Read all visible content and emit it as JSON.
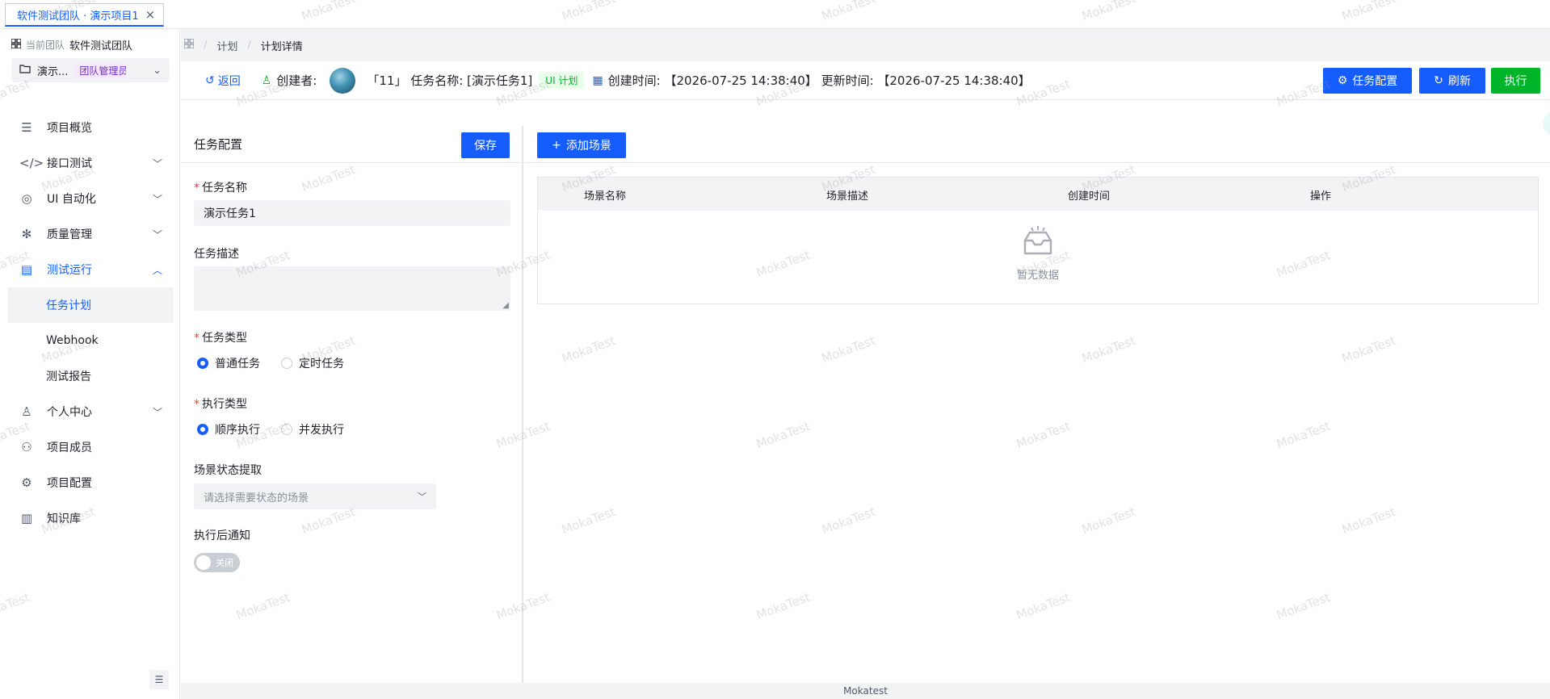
{
  "tab": {
    "label": "软件测试团队 · 演示项目1"
  },
  "sidebar": {
    "team_prefix": "当前团队",
    "team_name": "软件测试团队",
    "project_name": "演示...",
    "project_tag": "团队管理员",
    "items": [
      {
        "label": "项目概览"
      },
      {
        "label": "接口测试"
      },
      {
        "label": "UI 自动化"
      },
      {
        "label": "质量管理"
      },
      {
        "label": "测试运行"
      },
      {
        "label": "任务计划"
      },
      {
        "label": "Webhook"
      },
      {
        "label": "测试报告"
      },
      {
        "label": "个人中心"
      },
      {
        "label": "项目成员"
      },
      {
        "label": "项目配置"
      },
      {
        "label": "知识库"
      }
    ]
  },
  "breadcrumb": {
    "level1": "计划",
    "level2": "计划详情"
  },
  "header": {
    "back": "返回",
    "creator_label": "创建者:",
    "task_info": "「11」 任务名称: [演示任务1]",
    "ui_tag": "UI 计划",
    "times": "创建时间: 【2026-07-25 14:38:40】 更新时间: 【2026-07-25 14:38:40】",
    "btn_config": "任务配置",
    "btn_refresh": "刷新",
    "btn_run": "执行"
  },
  "config": {
    "title": "任务配置",
    "save": "保存",
    "name_label": "任务名称",
    "name_value": "演示任务1",
    "desc_label": "任务描述",
    "type_label": "任务类型",
    "type_opt1": "普通任务",
    "type_opt2": "定时任务",
    "exec_label": "执行类型",
    "exec_opt1": "顺序执行",
    "exec_opt2": "并发执行",
    "scene_state_label": "场景状态提取",
    "scene_state_placeholder": "请选择需要状态的场景",
    "notify_label": "执行后通知",
    "notify_switch": "关闭"
  },
  "scenes": {
    "add_button": "添加场景",
    "columns": [
      "场景名称",
      "场景描述",
      "创建时间",
      "操作"
    ],
    "empty_text": "暂无数据"
  },
  "footer": {
    "text": "Mokatest"
  },
  "watermark": "MokaTest"
}
